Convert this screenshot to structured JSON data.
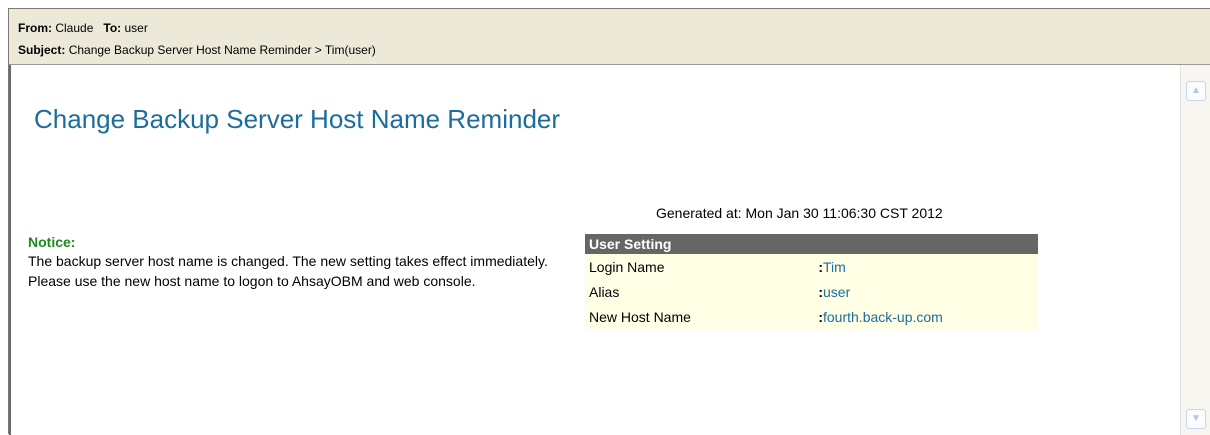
{
  "header": {
    "from_label": "From:",
    "from_value": "Claude",
    "to_label": "To:",
    "to_value": "user",
    "subject_label": "Subject:",
    "subject_value": "Change Backup Server Host Name Reminder > Tim(user)"
  },
  "email": {
    "title": "Change Backup Server Host Name Reminder",
    "generated": "Generated at: Mon Jan 30 11:06:30 CST 2012",
    "notice_label": "Notice:",
    "notice_text": "The backup server host name is changed. The new setting takes effect immediately. Please use the new host name to logon to AhsayOBM and web console.",
    "settings_title": "User Setting",
    "settings": [
      {
        "label": "Login Name",
        "value": "Tim"
      },
      {
        "label": "Alias",
        "value": "user"
      },
      {
        "label": "New Host Name",
        "value": "fourth.back-up.com"
      }
    ]
  },
  "colors": {
    "title": "#1b6e9c",
    "notice": "#1d8a1d",
    "table_header": "#666666",
    "table_row": "#ffffe6",
    "header_bg": "#ece9d8"
  },
  "icons": {
    "scroll_up": "chevron-up-icon",
    "scroll_down": "chevron-down-icon"
  }
}
